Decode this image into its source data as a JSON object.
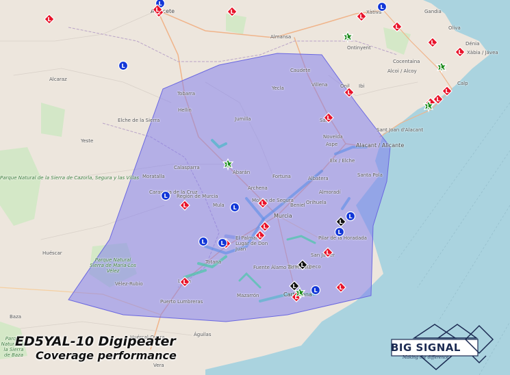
{
  "title": "ED5YAL-10 Digipeater",
  "subtitle": "Coverage performance",
  "logo": {
    "name": "BIG SIGNAL",
    "tagline": "Making the difference"
  },
  "colors": {
    "coverage": "#7b78f0",
    "sea": "#aad3df",
    "land": "#ede6dd",
    "red_station": "#e8132a",
    "blue_station": "#1237d8",
    "green_station": "#1a8a1a",
    "black_station": "#111111"
  },
  "places": [
    {
      "id": "albacete",
      "text": "Albacete"
    },
    {
      "id": "xativa",
      "text": "Xàtiva"
    },
    {
      "id": "gandia",
      "text": "Gandia"
    },
    {
      "id": "oliva",
      "text": "Oliva"
    },
    {
      "id": "almansa",
      "text": "Almansa"
    },
    {
      "id": "ontinyent",
      "text": "Ontinyent"
    },
    {
      "id": "cocentaina",
      "text": "Cocentaina"
    },
    {
      "id": "denia",
      "text": "Dénia"
    },
    {
      "id": "xabia",
      "text": "Xàbia / Jávea"
    },
    {
      "id": "alcoi",
      "text": "Alcoi / Alcoy"
    },
    {
      "id": "alcaraz",
      "text": "Alcaraz"
    },
    {
      "id": "caudete",
      "text": "Caudete"
    },
    {
      "id": "villena",
      "text": "Villena"
    },
    {
      "id": "onil",
      "text": "Onil"
    },
    {
      "id": "ibi",
      "text": "Ibi"
    },
    {
      "id": "calp",
      "text": "Calp"
    },
    {
      "id": "tobarra",
      "text": "Tobarra"
    },
    {
      "id": "yecla",
      "text": "Yecla"
    },
    {
      "id": "hellin",
      "text": "Hellín"
    },
    {
      "id": "elche_sierra",
      "text": "Elche de la Sierra"
    },
    {
      "id": "jumilla",
      "text": "Jumilla"
    },
    {
      "id": "sax",
      "text": "Sax"
    },
    {
      "id": "santjoan",
      "text": "Sant Joan d'Alacant"
    },
    {
      "id": "alacant",
      "text": "Alacant / Alicante"
    },
    {
      "id": "yeste",
      "text": "Yeste"
    },
    {
      "id": "novelda",
      "text": "Novelda"
    },
    {
      "id": "aspe",
      "text": "Aspe"
    },
    {
      "id": "elx",
      "text": "Elx / Elche"
    },
    {
      "id": "calasparra",
      "text": "Calasparra"
    },
    {
      "id": "abaran",
      "text": "Abarán"
    },
    {
      "id": "fortuna",
      "text": "Fortuna"
    },
    {
      "id": "santapola",
      "text": "Santa Pola"
    },
    {
      "id": "albatera",
      "text": "Albatera"
    },
    {
      "id": "archena",
      "text": "Archena"
    },
    {
      "id": "moratalla",
      "text": "Moratalla"
    },
    {
      "id": "caravaca",
      "text": "Caravaca de la Cruz"
    },
    {
      "id": "almoradi",
      "text": "Almoradí"
    },
    {
      "id": "orihuela",
      "text": "Orihuela"
    },
    {
      "id": "molina",
      "text": "Molina de Segura"
    },
    {
      "id": "beniel",
      "text": "Beniel"
    },
    {
      "id": "regionmurcia",
      "text": "Región de Murcia"
    },
    {
      "id": "mula",
      "text": "Mula"
    },
    {
      "id": "murcia",
      "text": "Murcia"
    },
    {
      "id": "pilar",
      "text": "Pilar de la Horadada"
    },
    {
      "id": "sanjavier",
      "text": "San Javier"
    },
    {
      "id": "parque_cazorla",
      "text": "Parque Natural de la Sierra de Cazorla, Segura y las Villas"
    },
    {
      "id": "huescar",
      "text": "Huéscar"
    },
    {
      "id": "elpalmar",
      "text": "El Palmar o Lugar de Don Juan"
    },
    {
      "id": "totana",
      "text": "Totana"
    },
    {
      "id": "fuente",
      "text": "Fuente Álamo de Murcia"
    },
    {
      "id": "torre",
      "text": "Torre-Pacheco"
    },
    {
      "id": "parque_velez",
      "text": "Parque Natural Sierra de María-Los Vélez"
    },
    {
      "id": "velez",
      "text": "Vélez-Rubio"
    },
    {
      "id": "lorca",
      "text": "Lorca"
    },
    {
      "id": "mazarron",
      "text": "Mazarrón"
    },
    {
      "id": "cartagena",
      "text": "Cartagena"
    },
    {
      "id": "puerto",
      "text": "Puerto Lumbreras"
    },
    {
      "id": "baza",
      "text": "Baza"
    },
    {
      "id": "huercal",
      "text": "Huércal-Overa"
    },
    {
      "id": "aguilas",
      "text": "Águilas"
    },
    {
      "id": "parque_baza",
      "text": "Parque Natural de la Sierra de Baza"
    },
    {
      "id": "vera",
      "text": "Vera"
    }
  ],
  "stations": [
    {
      "type": "red",
      "label": "L"
    },
    {
      "type": "red",
      "label": "L"
    },
    {
      "type": "blue",
      "label": "L"
    },
    {
      "type": "red",
      "label": "L"
    },
    {
      "type": "red",
      "label": "L"
    },
    {
      "type": "blue",
      "label": "L"
    },
    {
      "type": "red",
      "label": "L"
    },
    {
      "type": "green",
      "label": "L"
    },
    {
      "type": "red",
      "label": "L"
    },
    {
      "type": "blue",
      "label": "L"
    },
    {
      "type": "green",
      "label": "L"
    },
    {
      "type": "red",
      "label": "L"
    },
    {
      "type": "red",
      "label": "L"
    },
    {
      "type": "red",
      "label": "L"
    },
    {
      "type": "red",
      "label": "L"
    },
    {
      "type": "red",
      "label": "L"
    },
    {
      "type": "green",
      "label": "L"
    },
    {
      "type": "red",
      "label": "L"
    },
    {
      "type": "green",
      "label": "L"
    },
    {
      "type": "blue",
      "label": "L"
    },
    {
      "type": "red",
      "label": "L"
    },
    {
      "type": "blue",
      "label": "L"
    },
    {
      "type": "red",
      "label": "L"
    },
    {
      "type": "red",
      "label": "L"
    },
    {
      "type": "blue",
      "label": "L"
    },
    {
      "type": "black",
      "label": "L"
    },
    {
      "type": "blue",
      "label": "L"
    },
    {
      "type": "red",
      "label": "L"
    },
    {
      "type": "blue",
      "label": "L"
    },
    {
      "type": "red",
      "label": "L"
    },
    {
      "type": "red",
      "label": "L"
    },
    {
      "type": "blue",
      "label": "L"
    },
    {
      "type": "red",
      "label": "L"
    },
    {
      "type": "red",
      "label": "L"
    },
    {
      "type": "black",
      "label": "L"
    },
    {
      "type": "red",
      "label": "L"
    },
    {
      "type": "black",
      "label": "L"
    },
    {
      "type": "green",
      "label": "L"
    },
    {
      "type": "blue",
      "label": "L"
    },
    {
      "type": "red",
      "label": "L"
    }
  ]
}
